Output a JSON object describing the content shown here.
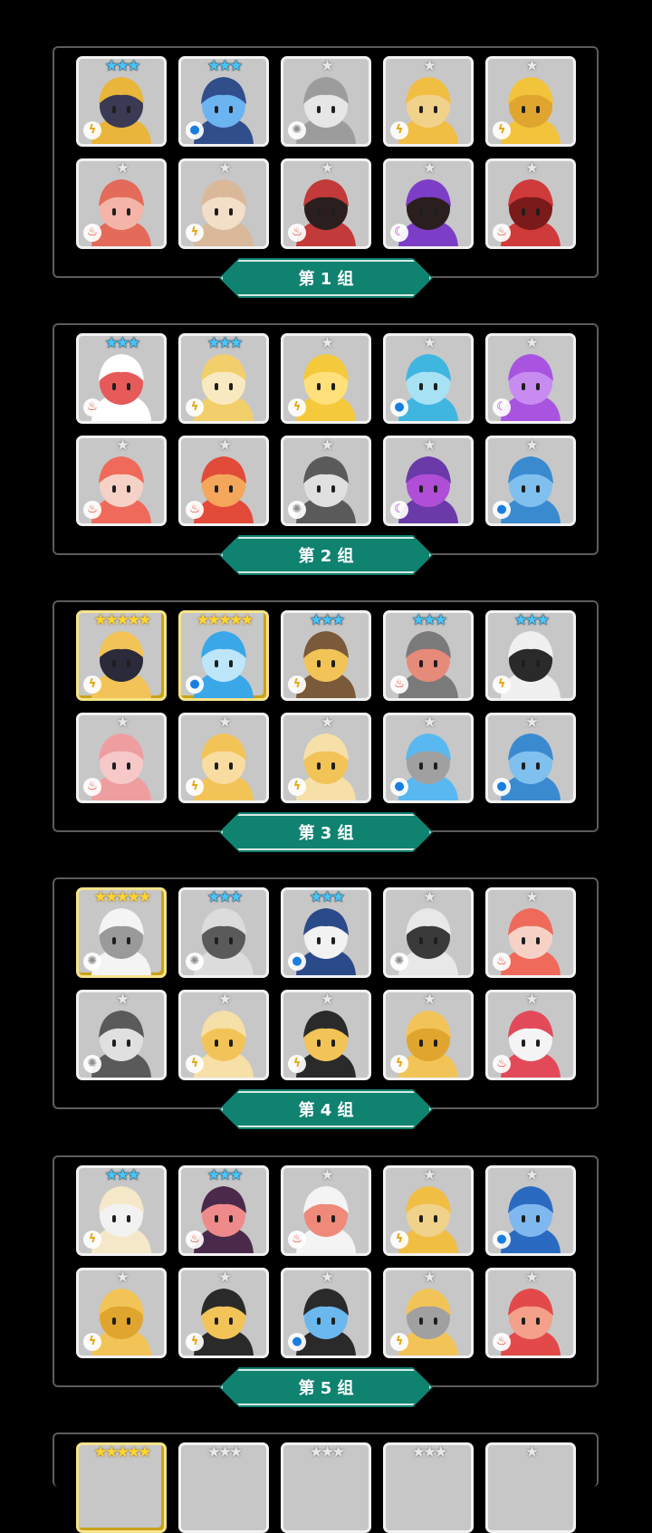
{
  "colors": {
    "background": "#000000",
    "frame": "#5c5c5c",
    "banner": "#0f8270",
    "card": "#c7c7c7"
  },
  "icons": {
    "fire": "fire-icon",
    "water": "water-drop-icon",
    "thunder": "lightning-icon",
    "light": "light-gear-icon",
    "dark": "dark-moon-icon"
  },
  "groups": [
    {
      "label": "第 1 组",
      "heroes": [
        {
          "stars": 3,
          "tier": "blue",
          "element": "thunder",
          "palette": [
            "#e9b53a",
            "#3a3a55"
          ]
        },
        {
          "stars": 3,
          "tier": "blue",
          "element": "water",
          "palette": [
            "#2f4e8a",
            "#6cb3f2"
          ]
        },
        {
          "stars": 1,
          "tier": "gray",
          "element": "light",
          "palette": [
            "#9c9c9c",
            "#e6e6e6"
          ]
        },
        {
          "stars": 1,
          "tier": "gray",
          "element": "thunder",
          "palette": [
            "#f1be44",
            "#f1d28a"
          ]
        },
        {
          "stars": 1,
          "tier": "gray",
          "element": "thunder",
          "palette": [
            "#f2c43c",
            "#e0a52e"
          ]
        },
        {
          "stars": 1,
          "tier": "gray",
          "element": "fire",
          "palette": [
            "#e46a5a",
            "#f5b4a8"
          ]
        },
        {
          "stars": 1,
          "tier": "gray",
          "element": "thunder",
          "palette": [
            "#d9b99a",
            "#f3dfc7"
          ]
        },
        {
          "stars": 1,
          "tier": "gray",
          "element": "fire",
          "palette": [
            "#c33a3a",
            "#2a1e1e"
          ]
        },
        {
          "stars": 1,
          "tier": "gray",
          "element": "dark",
          "palette": [
            "#7c3ec7",
            "#2a1e1e"
          ]
        },
        {
          "stars": 1,
          "tier": "gray",
          "element": "fire",
          "palette": [
            "#cf3a3a",
            "#7a1a1a"
          ]
        }
      ]
    },
    {
      "label": "第 2 组",
      "heroes": [
        {
          "stars": 3,
          "tier": "blue",
          "element": "fire",
          "palette": [
            "#ffffff",
            "#e65a5a"
          ]
        },
        {
          "stars": 3,
          "tier": "blue",
          "element": "thunder",
          "palette": [
            "#f2cf6a",
            "#f8eac0"
          ]
        },
        {
          "stars": 1,
          "tier": "gray",
          "element": "thunder",
          "palette": [
            "#f4ca3c",
            "#ffe07a"
          ]
        },
        {
          "stars": 1,
          "tier": "gray",
          "element": "water",
          "palette": [
            "#3fb6e0",
            "#a6e2f4"
          ]
        },
        {
          "stars": 1,
          "tier": "gray",
          "element": "dark",
          "palette": [
            "#a854e0",
            "#c88cf0"
          ]
        },
        {
          "stars": 1,
          "tier": "gray",
          "element": "fire",
          "palette": [
            "#ef6a5a",
            "#f6d2c6"
          ]
        },
        {
          "stars": 1,
          "tier": "gray",
          "element": "fire",
          "palette": [
            "#e24a3a",
            "#f4a65a"
          ]
        },
        {
          "stars": 1,
          "tier": "gray",
          "element": "light",
          "palette": [
            "#5a5a5a",
            "#e0e0e0"
          ]
        },
        {
          "stars": 1,
          "tier": "gray",
          "element": "dark",
          "palette": [
            "#6a3aa8",
            "#b04ed8"
          ]
        },
        {
          "stars": 1,
          "tier": "gray",
          "element": "water",
          "palette": [
            "#3a8ad0",
            "#7fc0ee"
          ]
        }
      ]
    },
    {
      "label": "第 3 组",
      "heroes": [
        {
          "stars": 5,
          "tier": "gold",
          "element": "thunder",
          "palette": [
            "#f2c458",
            "#2a2a3a"
          ]
        },
        {
          "stars": 5,
          "tier": "gold",
          "element": "water",
          "palette": [
            "#3aa8e8",
            "#bde6fa"
          ]
        },
        {
          "stars": 3,
          "tier": "blue",
          "element": "thunder",
          "palette": [
            "#7a5a3a",
            "#f2c458"
          ]
        },
        {
          "stars": 3,
          "tier": "blue",
          "element": "fire",
          "palette": [
            "#7a7a7a",
            "#e68a7a"
          ]
        },
        {
          "stars": 3,
          "tier": "blue",
          "element": "thunder",
          "palette": [
            "#f0f0f0",
            "#2a2a2a"
          ]
        },
        {
          "stars": 1,
          "tier": "gray",
          "element": "fire",
          "palette": [
            "#ef9ea0",
            "#f7c8c8"
          ]
        },
        {
          "stars": 1,
          "tier": "gray",
          "element": "thunder",
          "palette": [
            "#f2c458",
            "#f8dca0"
          ]
        },
        {
          "stars": 1,
          "tier": "gray",
          "element": "thunder",
          "palette": [
            "#f6e0a8",
            "#f2c458"
          ]
        },
        {
          "stars": 1,
          "tier": "gray",
          "element": "water",
          "palette": [
            "#5ab8f0",
            "#a0a0a0"
          ]
        },
        {
          "stars": 1,
          "tier": "gray",
          "element": "water",
          "palette": [
            "#3a8ad0",
            "#7fc0ee"
          ]
        }
      ]
    },
    {
      "label": "第 4 组",
      "heroes": [
        {
          "stars": 5,
          "tier": "gold",
          "element": "light",
          "palette": [
            "#f4f4f4",
            "#9a9a9a"
          ]
        },
        {
          "stars": 3,
          "tier": "blue",
          "element": "light",
          "palette": [
            "#dcdcdc",
            "#5a5a5a"
          ]
        },
        {
          "stars": 3,
          "tier": "blue",
          "element": "water",
          "palette": [
            "#2a4a8a",
            "#f2f2f2"
          ]
        },
        {
          "stars": 1,
          "tier": "gray",
          "element": "light",
          "palette": [
            "#e8e8e8",
            "#3a3a3a"
          ]
        },
        {
          "stars": 1,
          "tier": "gray",
          "element": "fire",
          "palette": [
            "#ef6a5a",
            "#f6d2c6"
          ]
        },
        {
          "stars": 1,
          "tier": "gray",
          "element": "light",
          "palette": [
            "#5a5a5a",
            "#e0e0e0"
          ]
        },
        {
          "stars": 1,
          "tier": "gray",
          "element": "thunder",
          "palette": [
            "#f6e0a8",
            "#f2c458"
          ]
        },
        {
          "stars": 1,
          "tier": "gray",
          "element": "thunder",
          "palette": [
            "#2a2a2a",
            "#f2c458"
          ]
        },
        {
          "stars": 1,
          "tier": "gray",
          "element": "thunder",
          "palette": [
            "#f2c458",
            "#e0a52e"
          ]
        },
        {
          "stars": 1,
          "tier": "gray",
          "element": "fire",
          "palette": [
            "#e24a5a",
            "#f4f4f4"
          ]
        }
      ]
    },
    {
      "label": "第 5 组",
      "heroes": [
        {
          "stars": 3,
          "tier": "blue",
          "element": "thunder",
          "palette": [
            "#f4e8c8",
            "#f2f2f2"
          ]
        },
        {
          "stars": 3,
          "tier": "blue",
          "element": "fire",
          "palette": [
            "#4a2a4a",
            "#ef8a8a"
          ]
        },
        {
          "stars": 1,
          "tier": "gray",
          "element": "fire",
          "palette": [
            "#f4f4f4",
            "#ef8a7a"
          ]
        },
        {
          "stars": 1,
          "tier": "gray",
          "element": "thunder",
          "palette": [
            "#f1be44",
            "#f1d28a"
          ]
        },
        {
          "stars": 1,
          "tier": "gray",
          "element": "water",
          "palette": [
            "#2a6ac0",
            "#7fb8ee"
          ]
        },
        {
          "stars": 1,
          "tier": "gray",
          "element": "thunder",
          "palette": [
            "#f2c458",
            "#e0a52e"
          ]
        },
        {
          "stars": 1,
          "tier": "gray",
          "element": "thunder",
          "palette": [
            "#2a2a2a",
            "#f2c458"
          ]
        },
        {
          "stars": 1,
          "tier": "gray",
          "element": "water",
          "palette": [
            "#2a2a2a",
            "#6ab8ee"
          ]
        },
        {
          "stars": 1,
          "tier": "gray",
          "element": "thunder",
          "palette": [
            "#f2c458",
            "#a0a0a0"
          ]
        },
        {
          "stars": 1,
          "tier": "gray",
          "element": "fire",
          "palette": [
            "#e24a4a",
            "#f4a08a"
          ]
        }
      ]
    }
  ],
  "partial_group": {
    "heroes": [
      {
        "stars": 5,
        "tier": "gold"
      },
      {
        "stars": 3,
        "tier": "gray"
      },
      {
        "stars": 3,
        "tier": "gray"
      },
      {
        "stars": 3,
        "tier": "gray"
      },
      {
        "stars": 1,
        "tier": "gray"
      }
    ]
  }
}
